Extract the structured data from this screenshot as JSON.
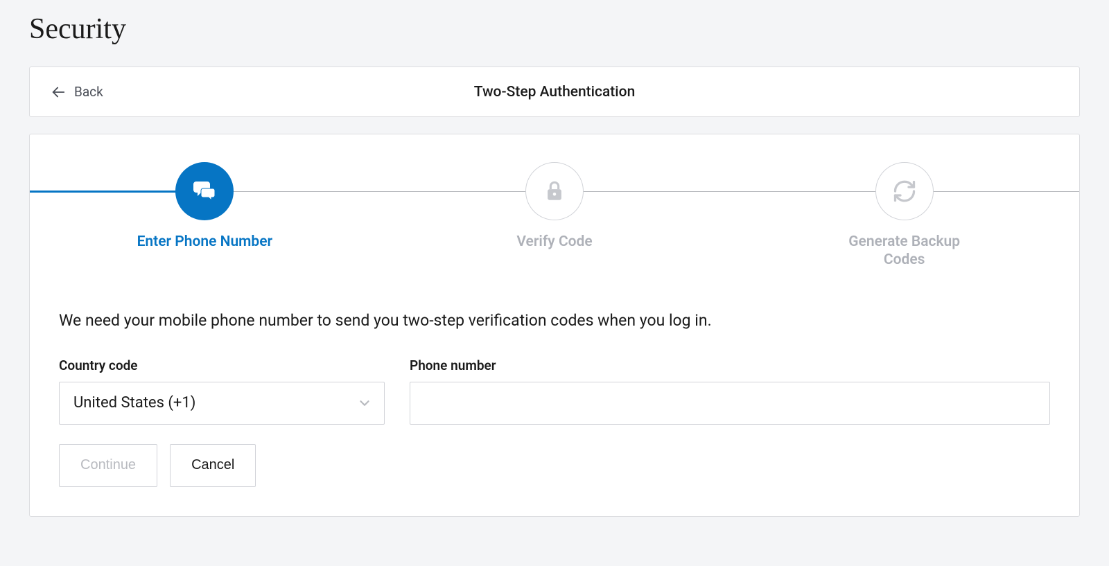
{
  "page": {
    "title": "Security"
  },
  "header": {
    "back_label": "Back",
    "title": "Two-Step Authentication"
  },
  "stepper": {
    "steps": [
      {
        "label": "Enter Phone Number",
        "icon": "chat-icon",
        "active": true
      },
      {
        "label": "Verify Code",
        "icon": "lock-icon",
        "active": false
      },
      {
        "label": "Generate Backup Codes",
        "icon": "refresh-icon",
        "active": false
      }
    ]
  },
  "content": {
    "description": "We need your mobile phone number to send you two-step verification codes when you log in."
  },
  "form": {
    "country_label": "Country code",
    "country_value": "United States (+1)",
    "phone_label": "Phone number",
    "phone_value": ""
  },
  "buttons": {
    "continue": "Continue",
    "cancel": "Cancel"
  },
  "colors": {
    "accent": "#0675c4",
    "muted": "#aeb1b8",
    "border": "#d1d3d8"
  }
}
